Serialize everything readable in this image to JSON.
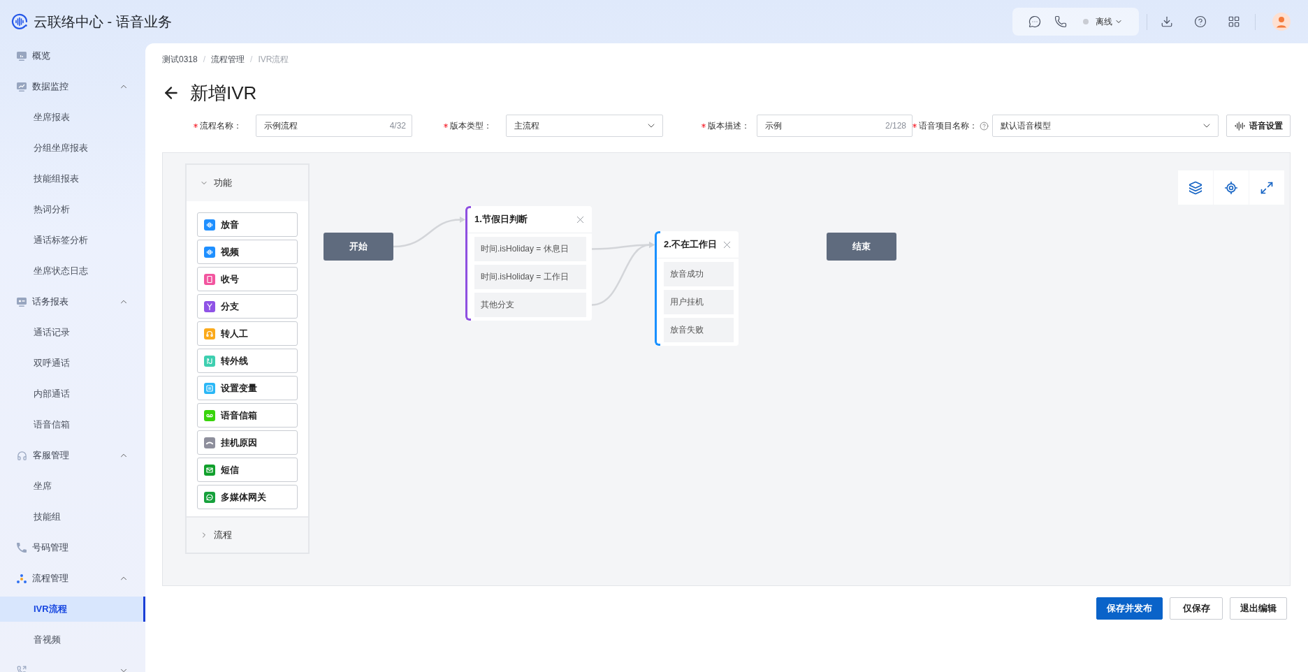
{
  "app": {
    "title": "云联络中心 - 语音业务"
  },
  "header": {
    "status": "离线"
  },
  "sidebar": {
    "items": [
      {
        "label": "概览",
        "selected": false
      },
      {
        "label": "数据监控",
        "expanded": true,
        "children": [
          {
            "label": "坐席报表",
            "selected": false
          },
          {
            "label": "分组坐席报表",
            "selected": false
          },
          {
            "label": "技能组报表",
            "selected": false
          },
          {
            "label": "热词分析",
            "selected": false
          },
          {
            "label": "通话标签分析",
            "selected": false
          },
          {
            "label": "坐席状态日志",
            "selected": false
          }
        ]
      },
      {
        "label": "话务报表",
        "expanded": true,
        "children": [
          {
            "label": "通话记录",
            "selected": false
          },
          {
            "label": "双呼通话",
            "selected": false
          },
          {
            "label": "内部通话",
            "selected": false
          },
          {
            "label": "语音信箱",
            "selected": false
          }
        ]
      },
      {
        "label": "客服管理",
        "expanded": true,
        "children": [
          {
            "label": "坐席",
            "selected": false
          },
          {
            "label": "技能组",
            "selected": false
          }
        ]
      },
      {
        "label": "号码管理",
        "selected": false
      },
      {
        "label": "流程管理",
        "expanded": true,
        "children": [
          {
            "label": "IVR流程",
            "selected": true
          },
          {
            "label": "音视频",
            "selected": false
          }
        ]
      },
      {
        "expanded": false
      }
    ]
  },
  "breadcrumb": {
    "separator": "/",
    "items": [
      "测试0318",
      "流程管理",
      "IVR流程"
    ]
  },
  "page": {
    "title": "新增IVR"
  },
  "form": {
    "fields": [
      {
        "kind": "input",
        "label": "流程名称：",
        "required": true,
        "value": "示例流程",
        "count": "4/32"
      },
      {
        "kind": "select",
        "label": "版本类型：",
        "required": true,
        "value": "主流程"
      },
      {
        "kind": "input",
        "label": "版本描述：",
        "required": true,
        "value": "示例",
        "count": "2/128"
      },
      {
        "kind": "select",
        "label": "语音项目名称：",
        "required": true,
        "help": true,
        "value": "默认语音模型"
      }
    ],
    "voice_settings_button": "语音设置"
  },
  "canvas": {
    "palette": {
      "sections": [
        {
          "title": "功能",
          "expanded": true,
          "items": [
            {
              "label": "放音",
              "color": "#1e8fff"
            },
            {
              "label": "视频",
              "color": "#1e8fff"
            },
            {
              "label": "收号",
              "color": "#f2559f"
            },
            {
              "label": "分支",
              "color": "#8f53e6"
            },
            {
              "label": "转人工",
              "color": "#fbaa1b"
            },
            {
              "label": "转外线",
              "color": "#3ecfb0"
            },
            {
              "label": "设置变量",
              "color": "#2ab7f6"
            },
            {
              "label": "语音信箱",
              "color": "#38d40b"
            },
            {
              "label": "挂机原因",
              "color": "#8e8f9c"
            },
            {
              "label": "短信",
              "color": "#11a02c"
            },
            {
              "label": "多媒体网关",
              "color": "#17a13c"
            }
          ]
        },
        {
          "title": "流程",
          "expanded": false
        }
      ]
    },
    "nodes": [
      {
        "kind": "terminal",
        "label": "开始",
        "connected": true
      },
      {
        "kind": "branch",
        "title": "1.节假日判断",
        "color": "#8e4fe0",
        "branches": [
          {
            "label": "时间.isHoliday = 休息日",
            "connected": true
          },
          {
            "label": "时间.isHoliday = 工作日",
            "connected": false
          },
          {
            "label": "其他分支",
            "connected": true
          }
        ]
      },
      {
        "kind": "branch",
        "title": "2.不在工作日",
        "color": "#1890ff",
        "branches": [
          {
            "label": "放音成功",
            "connected": false
          },
          {
            "label": "用户挂机",
            "connected": false
          },
          {
            "label": "放音失败",
            "connected": false
          }
        ]
      },
      {
        "kind": "terminal",
        "label": "结束"
      }
    ]
  },
  "actions": [
    {
      "label": "保存并发布",
      "kind": "primary"
    },
    {
      "label": "仅保存",
      "kind": "default"
    },
    {
      "label": "退出编辑",
      "kind": "default"
    }
  ]
}
